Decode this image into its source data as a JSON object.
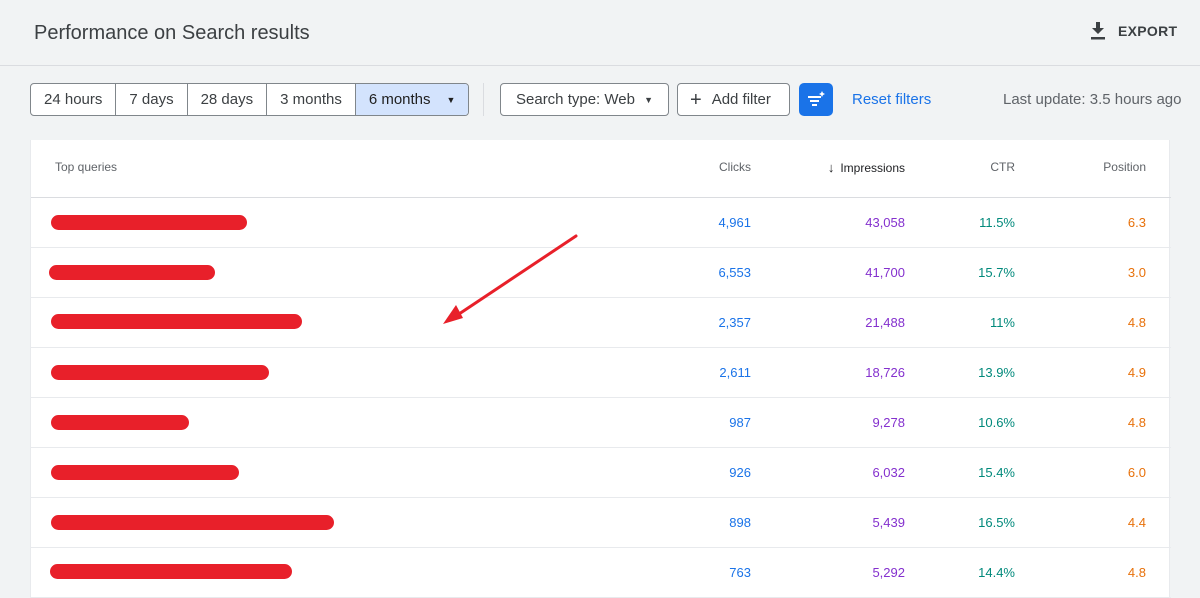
{
  "header": {
    "title": "Performance on Search results",
    "export_label": "EXPORT",
    "export_icon": "download-icon"
  },
  "filters": {
    "ranges": [
      {
        "label": "24 hours",
        "active": false
      },
      {
        "label": "7 days",
        "active": false
      },
      {
        "label": "28 days",
        "active": false
      },
      {
        "label": "3 months",
        "active": false
      },
      {
        "label": "6 months",
        "active": true
      }
    ],
    "search_type": "Search type: Web",
    "add_filter": "Add filter",
    "reset": "Reset filters",
    "last_update": "Last update: 3.5 hours ago"
  },
  "table": {
    "columns": {
      "query": "Top queries",
      "clicks": "Clicks",
      "impressions": "Impressions",
      "ctr": "CTR",
      "position": "Position"
    },
    "sort_column": "Impressions",
    "sort_direction": "descending",
    "rows": [
      {
        "clicks": "4,961",
        "impressions": "43,058",
        "ctr": "11.5%",
        "position": "6.3"
      },
      {
        "clicks": "6,553",
        "impressions": "41,700",
        "ctr": "15.7%",
        "position": "3.0"
      },
      {
        "clicks": "2,357",
        "impressions": "21,488",
        "ctr": "11%",
        "position": "4.8"
      },
      {
        "clicks": "2,611",
        "impressions": "18,726",
        "ctr": "13.9%",
        "position": "4.9"
      },
      {
        "clicks": "987",
        "impressions": "9,278",
        "ctr": "10.6%",
        "position": "4.8"
      },
      {
        "clicks": "926",
        "impressions": "6,032",
        "ctr": "15.4%",
        "position": "6.0"
      },
      {
        "clicks": "898",
        "impressions": "5,439",
        "ctr": "16.5%",
        "position": "4.4"
      },
      {
        "clicks": "763",
        "impressions": "5,292",
        "ctr": "14.4%",
        "position": "4.8"
      }
    ]
  },
  "colors": {
    "clicks": "#1a73e8",
    "impressions": "#8430ce",
    "ctr": "#00897b",
    "position": "#e8710a",
    "redaction": "#e8202a",
    "accent": "#1a73e8"
  }
}
